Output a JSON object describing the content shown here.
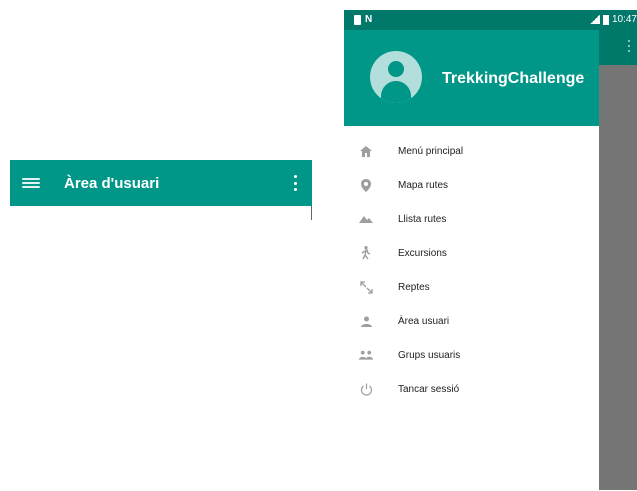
{
  "left_screen": {
    "toolbar": {
      "title": "Àrea d'usuari",
      "menu_icon": "hamburger-menu-icon",
      "more_icon": "more-vertical-icon"
    }
  },
  "right_screen": {
    "status_bar": {
      "time": "10:47"
    },
    "drawer": {
      "header": {
        "app_name": "TrekkingChallenge",
        "avatar_icon": "account-circle-icon"
      },
      "items": [
        {
          "label": "Menú principal",
          "icon": "home-icon"
        },
        {
          "label": "Mapa rutes",
          "icon": "location-pin-icon"
        },
        {
          "label": "Llista rutes",
          "icon": "terrain-icon"
        },
        {
          "label": "Excursions",
          "icon": "hiking-icon"
        },
        {
          "label": "Reptes",
          "icon": "expand-arrows-icon"
        },
        {
          "label": "Àrea usuari",
          "icon": "person-icon"
        },
        {
          "label": "Grups usuaris",
          "icon": "people-icon"
        },
        {
          "label": "Tancar sessió",
          "icon": "power-icon"
        }
      ]
    }
  },
  "colors": {
    "primary": "#009688",
    "primary_dark": "#00796b",
    "scrim": "#757575"
  }
}
